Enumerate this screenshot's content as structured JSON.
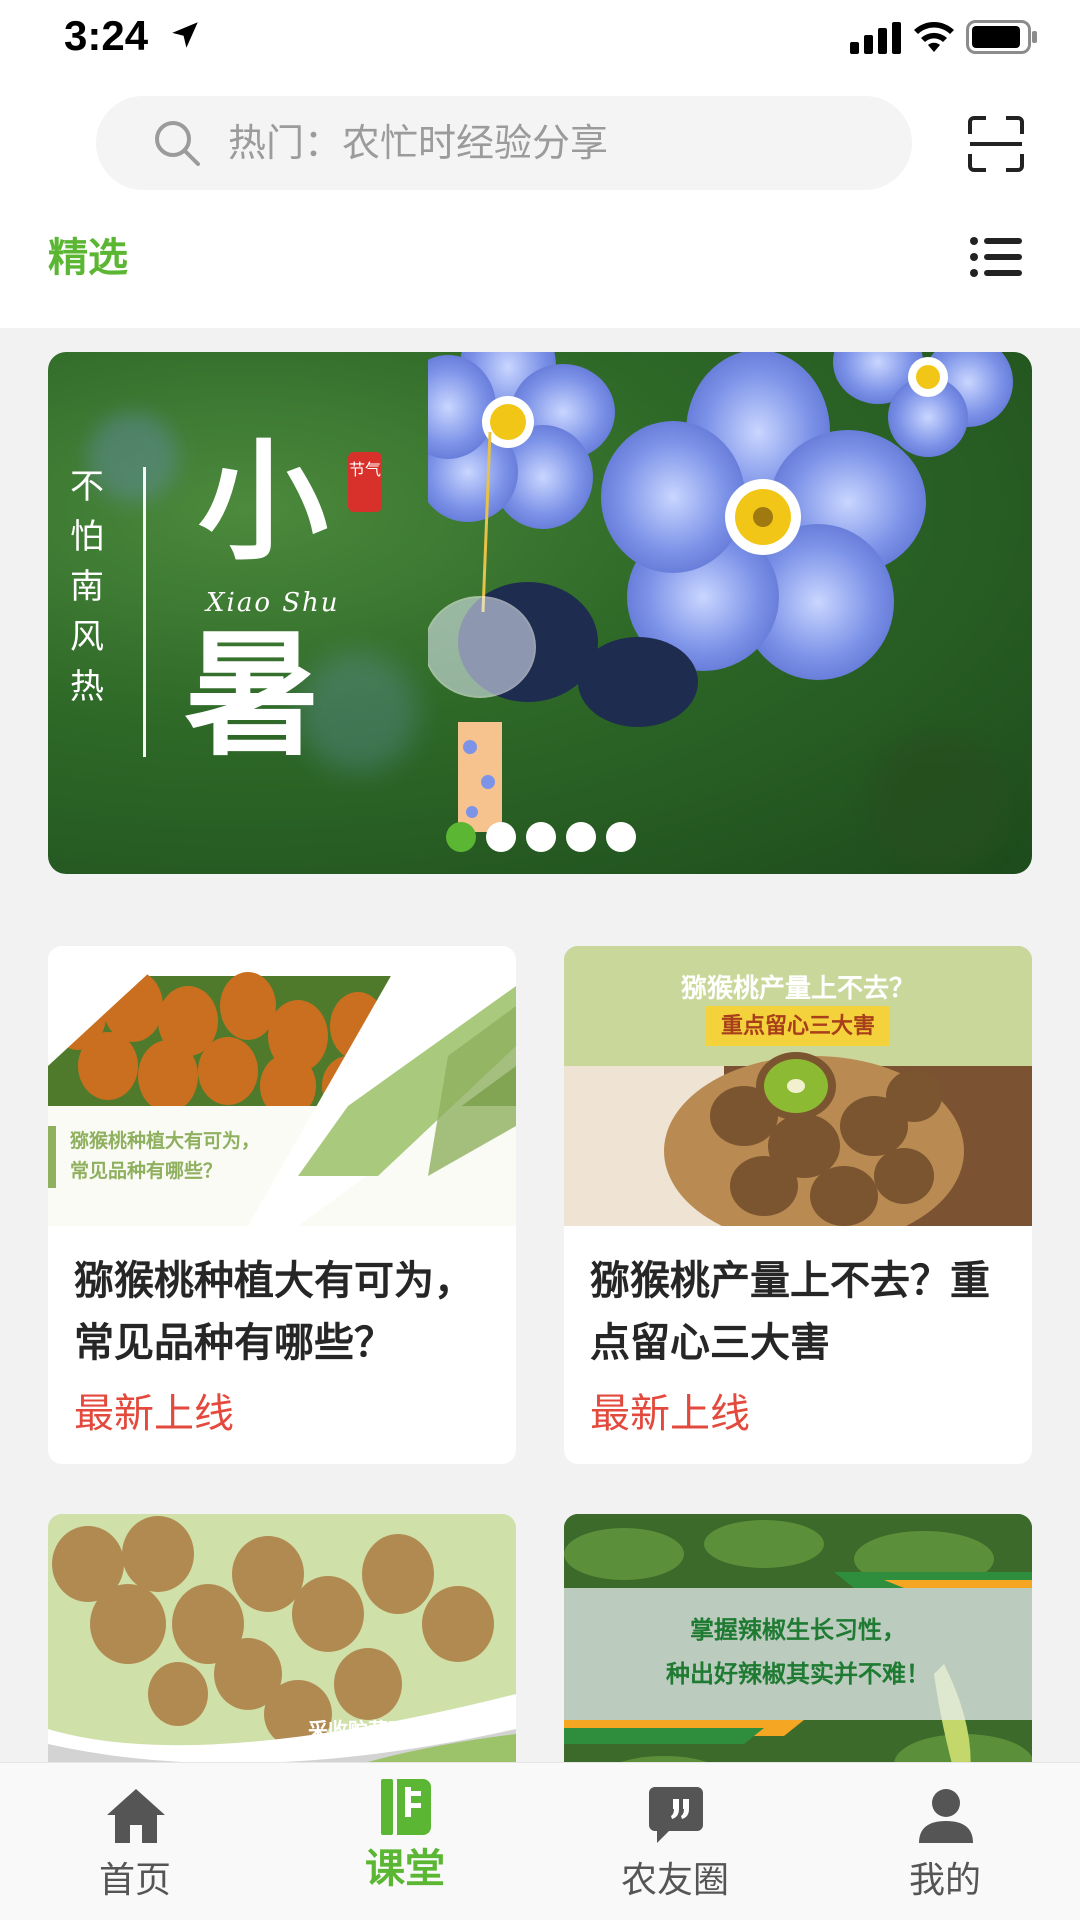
{
  "status_bar": {
    "time": "3:24"
  },
  "search": {
    "placeholder": "热门：农忙时经验分享"
  },
  "tabs": {
    "featured": "精选"
  },
  "banner": {
    "vertical_text": "不怕南风热",
    "title_char_1": "小",
    "title_char_2": "暑",
    "pinyin": "Xiao  Shu",
    "seal_text": "节气",
    "slide_count": 5,
    "active_slide": 1
  },
  "cards": [
    {
      "title": "猕猴桃种植大有可为，常见品种有哪些？",
      "badge": "最新上线",
      "image_text_1": "猕猴桃种植大有可为，",
      "image_text_2": "常见品种有哪些？"
    },
    {
      "title": "猕猴桃产量上不去？重点留心三大害",
      "badge": "最新上线",
      "image_text_1": "猕猴桃产量上不去？",
      "image_text_2": "重点留心三大害"
    },
    {
      "image_text_1": "采收贮藏两步曲，"
    },
    {
      "image_text_1": "掌握辣椒生长习性，",
      "image_text_2": "种出好辣椒其实并不难！"
    }
  ],
  "bottom_nav": [
    {
      "label": "首页",
      "icon": "home-icon"
    },
    {
      "label": "课堂",
      "icon": "notebook-icon",
      "active": true
    },
    {
      "label": "农友圈",
      "icon": "chat-quote-icon"
    },
    {
      "label": "我的",
      "icon": "user-icon"
    }
  ],
  "colors": {
    "accent": "#5bb733",
    "badge": "#e34a3d",
    "background": "#f2f2f2"
  }
}
